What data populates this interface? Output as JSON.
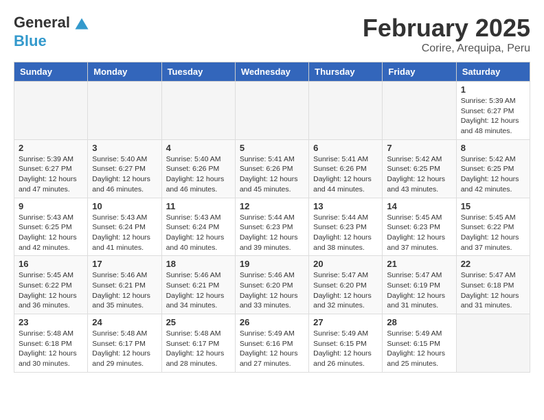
{
  "header": {
    "logo_general": "General",
    "logo_blue": "Blue",
    "month_year": "February 2025",
    "location": "Corire, Arequipa, Peru"
  },
  "days_of_week": [
    "Sunday",
    "Monday",
    "Tuesday",
    "Wednesday",
    "Thursday",
    "Friday",
    "Saturday"
  ],
  "weeks": [
    [
      {
        "day": "",
        "info": ""
      },
      {
        "day": "",
        "info": ""
      },
      {
        "day": "",
        "info": ""
      },
      {
        "day": "",
        "info": ""
      },
      {
        "day": "",
        "info": ""
      },
      {
        "day": "",
        "info": ""
      },
      {
        "day": "1",
        "info": "Sunrise: 5:39 AM\nSunset: 6:27 PM\nDaylight: 12 hours and 48 minutes."
      }
    ],
    [
      {
        "day": "2",
        "info": "Sunrise: 5:39 AM\nSunset: 6:27 PM\nDaylight: 12 hours and 47 minutes."
      },
      {
        "day": "3",
        "info": "Sunrise: 5:40 AM\nSunset: 6:27 PM\nDaylight: 12 hours and 46 minutes."
      },
      {
        "day": "4",
        "info": "Sunrise: 5:40 AM\nSunset: 6:26 PM\nDaylight: 12 hours and 46 minutes."
      },
      {
        "day": "5",
        "info": "Sunrise: 5:41 AM\nSunset: 6:26 PM\nDaylight: 12 hours and 45 minutes."
      },
      {
        "day": "6",
        "info": "Sunrise: 5:41 AM\nSunset: 6:26 PM\nDaylight: 12 hours and 44 minutes."
      },
      {
        "day": "7",
        "info": "Sunrise: 5:42 AM\nSunset: 6:25 PM\nDaylight: 12 hours and 43 minutes."
      },
      {
        "day": "8",
        "info": "Sunrise: 5:42 AM\nSunset: 6:25 PM\nDaylight: 12 hours and 42 minutes."
      }
    ],
    [
      {
        "day": "9",
        "info": "Sunrise: 5:43 AM\nSunset: 6:25 PM\nDaylight: 12 hours and 42 minutes."
      },
      {
        "day": "10",
        "info": "Sunrise: 5:43 AM\nSunset: 6:24 PM\nDaylight: 12 hours and 41 minutes."
      },
      {
        "day": "11",
        "info": "Sunrise: 5:43 AM\nSunset: 6:24 PM\nDaylight: 12 hours and 40 minutes."
      },
      {
        "day": "12",
        "info": "Sunrise: 5:44 AM\nSunset: 6:23 PM\nDaylight: 12 hours and 39 minutes."
      },
      {
        "day": "13",
        "info": "Sunrise: 5:44 AM\nSunset: 6:23 PM\nDaylight: 12 hours and 38 minutes."
      },
      {
        "day": "14",
        "info": "Sunrise: 5:45 AM\nSunset: 6:23 PM\nDaylight: 12 hours and 37 minutes."
      },
      {
        "day": "15",
        "info": "Sunrise: 5:45 AM\nSunset: 6:22 PM\nDaylight: 12 hours and 37 minutes."
      }
    ],
    [
      {
        "day": "16",
        "info": "Sunrise: 5:45 AM\nSunset: 6:22 PM\nDaylight: 12 hours and 36 minutes."
      },
      {
        "day": "17",
        "info": "Sunrise: 5:46 AM\nSunset: 6:21 PM\nDaylight: 12 hours and 35 minutes."
      },
      {
        "day": "18",
        "info": "Sunrise: 5:46 AM\nSunset: 6:21 PM\nDaylight: 12 hours and 34 minutes."
      },
      {
        "day": "19",
        "info": "Sunrise: 5:46 AM\nSunset: 6:20 PM\nDaylight: 12 hours and 33 minutes."
      },
      {
        "day": "20",
        "info": "Sunrise: 5:47 AM\nSunset: 6:20 PM\nDaylight: 12 hours and 32 minutes."
      },
      {
        "day": "21",
        "info": "Sunrise: 5:47 AM\nSunset: 6:19 PM\nDaylight: 12 hours and 31 minutes."
      },
      {
        "day": "22",
        "info": "Sunrise: 5:47 AM\nSunset: 6:18 PM\nDaylight: 12 hours and 31 minutes."
      }
    ],
    [
      {
        "day": "23",
        "info": "Sunrise: 5:48 AM\nSunset: 6:18 PM\nDaylight: 12 hours and 30 minutes."
      },
      {
        "day": "24",
        "info": "Sunrise: 5:48 AM\nSunset: 6:17 PM\nDaylight: 12 hours and 29 minutes."
      },
      {
        "day": "25",
        "info": "Sunrise: 5:48 AM\nSunset: 6:17 PM\nDaylight: 12 hours and 28 minutes."
      },
      {
        "day": "26",
        "info": "Sunrise: 5:49 AM\nSunset: 6:16 PM\nDaylight: 12 hours and 27 minutes."
      },
      {
        "day": "27",
        "info": "Sunrise: 5:49 AM\nSunset: 6:15 PM\nDaylight: 12 hours and 26 minutes."
      },
      {
        "day": "28",
        "info": "Sunrise: 5:49 AM\nSunset: 6:15 PM\nDaylight: 12 hours and 25 minutes."
      },
      {
        "day": "",
        "info": ""
      }
    ]
  ]
}
